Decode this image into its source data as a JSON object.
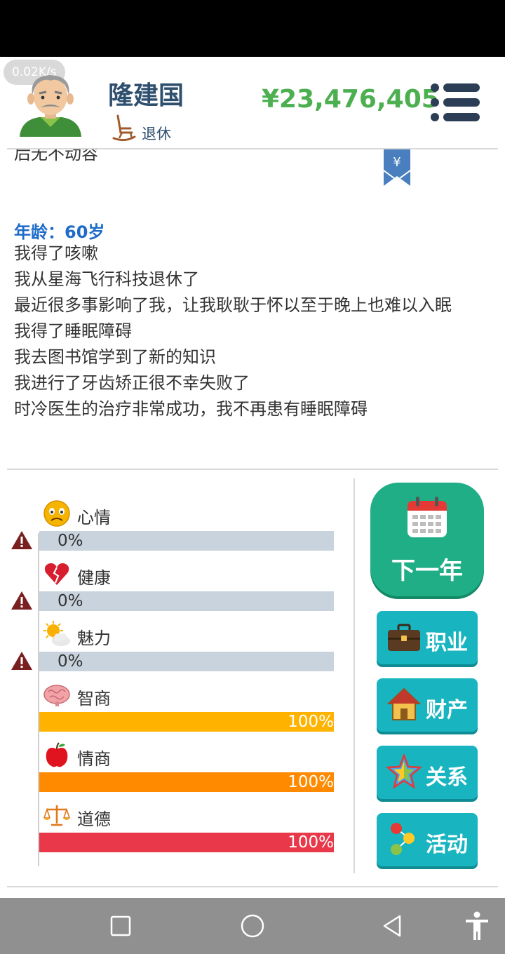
{
  "header": {
    "speed": "0.02K/s",
    "name": "隆建国",
    "status": "退休",
    "money": "¥23,476,405",
    "bookmark_symbol": "¥"
  },
  "log": {
    "partial_line": "后无不动容",
    "age": "年龄：60岁",
    "lines": [
      "我得了咳嗽",
      "我从星海飞行科技退休了",
      "最近很多事影响了我，让我耿耿于怀以至于晚上也难以入眠",
      "我得了睡眠障碍",
      "我去图书馆学到了新的知识",
      "我进行了牙齿矫正很不幸失败了",
      "时冷医生的治疗非常成功，我不再患有睡眠障碍"
    ]
  },
  "stats": [
    {
      "label": "心情",
      "value": "0%",
      "level": 0,
      "color": "#f5b400",
      "icon": "sad-face-icon",
      "warning": true
    },
    {
      "label": "健康",
      "value": "0%",
      "level": 0,
      "color": "#e02b3c",
      "icon": "broken-heart-icon",
      "warning": true
    },
    {
      "label": "魅力",
      "value": "0%",
      "level": 0,
      "color": "#f5b400",
      "icon": "sun-cloud-icon",
      "warning": true
    },
    {
      "label": "智商",
      "value": "100%",
      "level": 1,
      "color": "#ffb300",
      "icon": "brain-icon",
      "warning": false
    },
    {
      "label": "情商",
      "value": "100%",
      "level": 1,
      "color": "#ff8a00",
      "icon": "apple-icon",
      "warning": false
    },
    {
      "label": "道德",
      "value": "100%",
      "level": 1,
      "color": "#e8384a",
      "icon": "scales-icon",
      "warning": false
    }
  ],
  "actions": {
    "next_year": "下一年",
    "career": "职业",
    "assets": "财产",
    "relations": "关系",
    "activities": "活动"
  },
  "colors": {
    "accent_green": "#1fae85",
    "button_teal": "#18b5c0",
    "money_green": "#4caf50",
    "age_blue": "#1e6cc8"
  }
}
